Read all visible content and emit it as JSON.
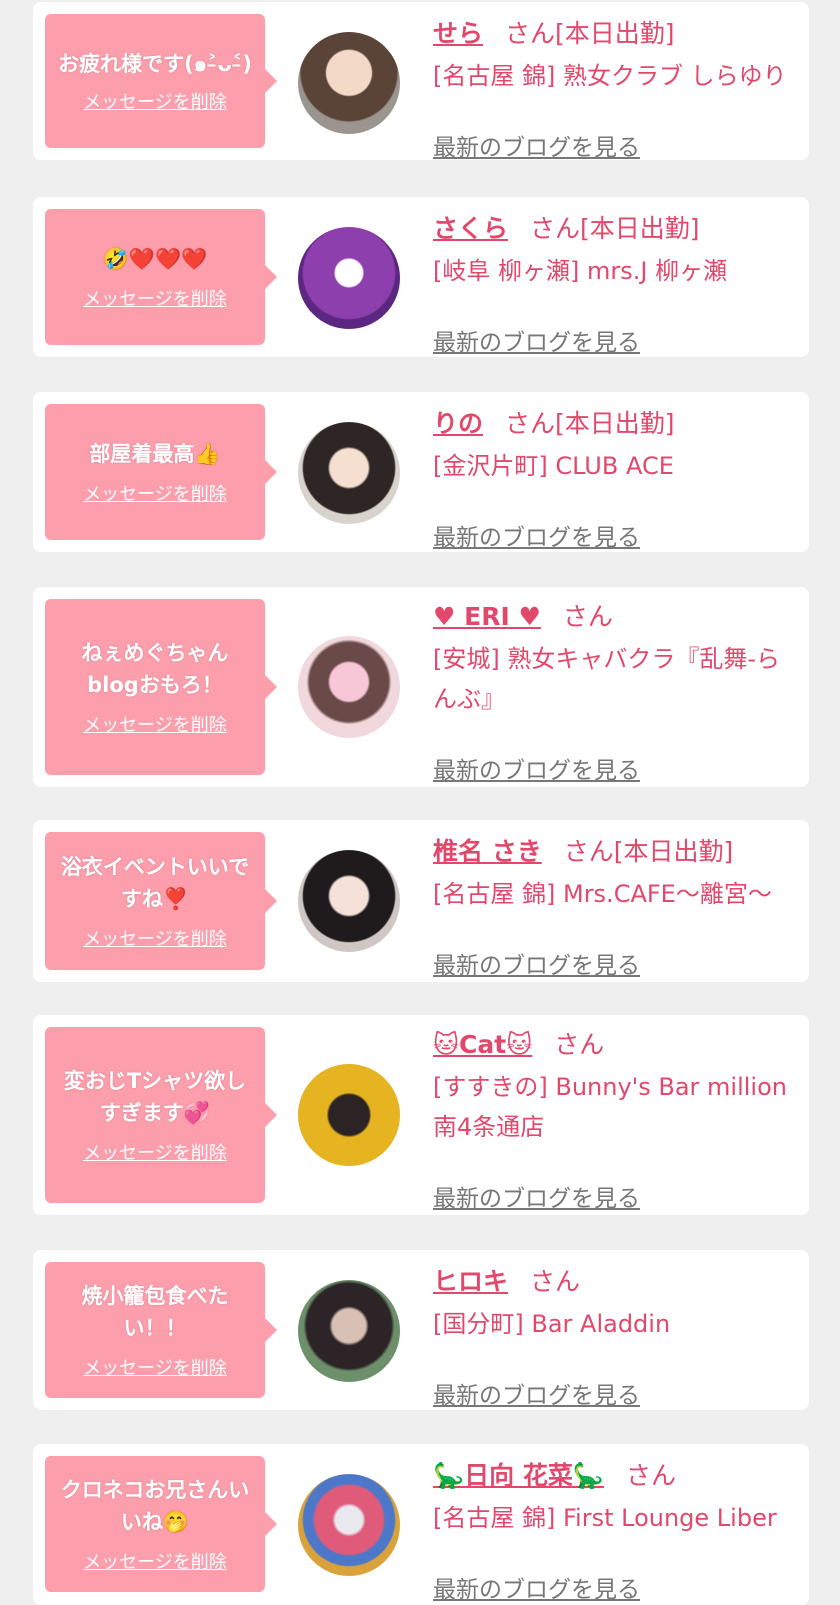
{
  "colors": {
    "accent": "#e2486b",
    "bubble": "#fc9eac",
    "link_gray": "#777777",
    "background": "#efefef"
  },
  "items": [
    {
      "message": "お疲れ様です(๑˃̵ᴗ˂̵)",
      "delete_label": "メッセージを削除",
      "name": "せら",
      "san": "さん[本日出勤]",
      "shop": "[名古屋 錦] 熟女クラブ しらゆり",
      "blog_label": "最新のブログを見る"
    },
    {
      "message": "🤣❤️❤️❤️",
      "delete_label": "メッセージを削除",
      "name": "さくら",
      "san": "さん[本日出勤]",
      "shop": "[岐阜 柳ヶ瀬] mrs.J 柳ヶ瀬",
      "blog_label": "最新のブログを見る"
    },
    {
      "message": "部屋着最高👍",
      "delete_label": "メッセージを削除",
      "name": "りの",
      "san": "さん[本日出勤]",
      "shop": "[金沢片町] CLUB ACE",
      "blog_label": "最新のブログを見る"
    },
    {
      "message": "ねぇめぐちゃん blogおもろ！",
      "delete_label": "メッセージを削除",
      "name": "♥ ERI ♥",
      "san": "さん",
      "shop": "[安城] 熟女キャバクラ『乱舞-らんぶ』",
      "blog_label": "最新のブログを見る"
    },
    {
      "message": "浴衣イベントいいですね❣️",
      "delete_label": "メッセージを削除",
      "name": "椎名 さき",
      "san": "さん[本日出勤]",
      "shop": "[名古屋 錦] Mrs.CAFE〜離宮〜",
      "blog_label": "最新のブログを見る"
    },
    {
      "message": "変おじTシャツ欲しすぎます💞",
      "delete_label": "メッセージを削除",
      "name": "🐱Cat🐱",
      "san": "さん",
      "shop": "[すすきの] Bunny's Bar million 南4条通店",
      "blog_label": "最新のブログを見る"
    },
    {
      "message": "焼小籠包食べたい！！",
      "delete_label": "メッセージを削除",
      "name": "ヒロキ",
      "san": "さん",
      "shop": "[国分町] Bar Aladdin",
      "blog_label": "最新のブログを見る"
    },
    {
      "message": "クロネコお兄さんいいね🤭",
      "delete_label": "メッセージを削除",
      "name": "🦕日向 花菜🦕",
      "san": "さん",
      "shop": "[名古屋 錦] First Lounge Liber",
      "blog_label": "最新のブログを見る"
    }
  ]
}
